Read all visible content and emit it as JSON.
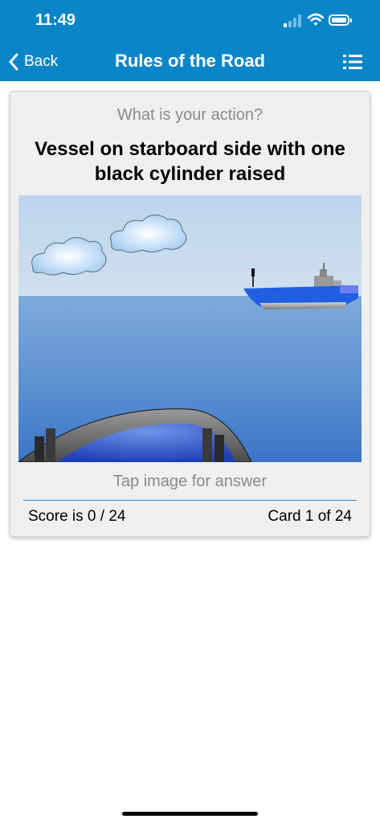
{
  "status_bar": {
    "time": "11:49"
  },
  "nav": {
    "back_label": "Back",
    "title": "Rules of the Road",
    "menu_icon": "list-icon"
  },
  "card": {
    "prompt": "What is your action?",
    "question": "Vessel on starboard side with one black cylinder raised",
    "tap_hint": "Tap image for answer",
    "score": "Score is 0 / 24",
    "card_count": "Card 1 of 24"
  },
  "colors": {
    "header": "#0a86c8",
    "divider": "#2b86c5",
    "ship_hull": "#1f5fe0"
  }
}
